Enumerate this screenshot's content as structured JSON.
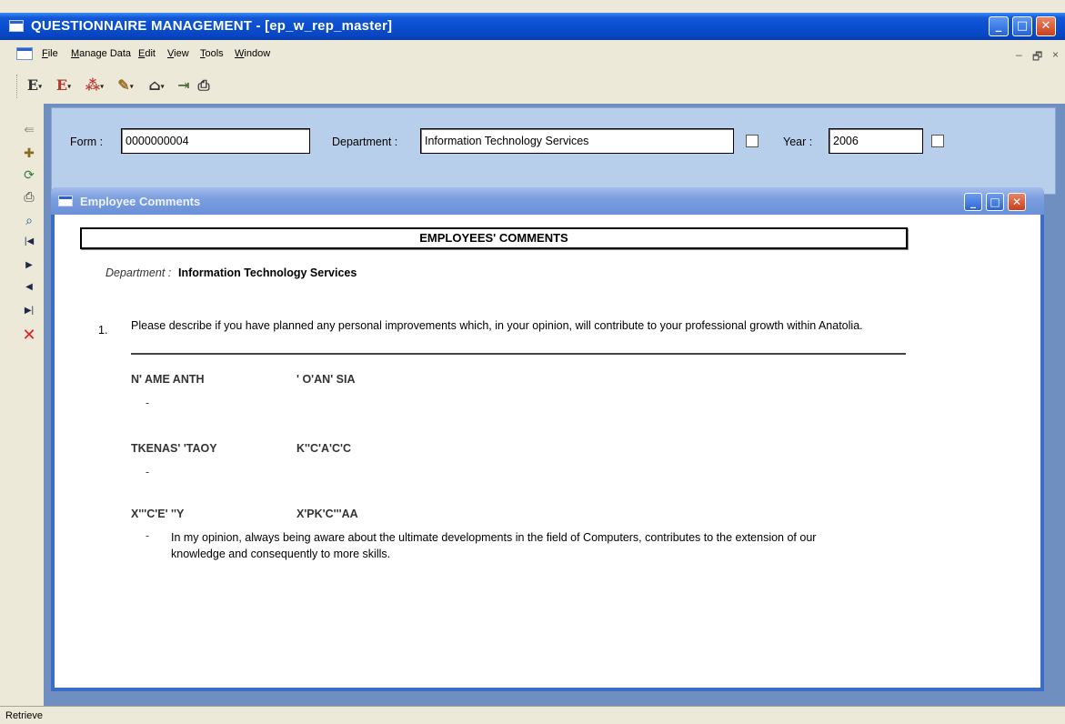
{
  "window": {
    "title": "QUESTIONNAIRE MANAGEMENT - [ep_w_rep_master]"
  },
  "menu": [
    "File",
    "Manage Data",
    "Edit",
    "View",
    "Tools",
    "Window"
  ],
  "mdi_controls": {
    "minimize": "–",
    "restore": "🗗",
    "close": "×"
  },
  "toolbar": {
    "buttons": [
      {
        "name": "en-language-icon",
        "glyph": "E"
      },
      {
        "name": "gr-language-icon",
        "glyph": "E"
      },
      {
        "name": "group-icon",
        "glyph": "⁂"
      },
      {
        "name": "brush-icon",
        "glyph": "✎"
      },
      {
        "name": "institution-icon",
        "glyph": "⌂"
      },
      {
        "name": "exit-icon",
        "glyph": "⇥"
      },
      {
        "name": "print-icon",
        "glyph": "⎙"
      }
    ]
  },
  "side_toolbar": [
    "⇚",
    "✚",
    "⟳",
    "⎙",
    "⌕",
    "|◀",
    "▶",
    "◀",
    "▶|",
    "✕"
  ],
  "form": {
    "form_label": "Form :",
    "form_value": "0000000004",
    "department_label": "Department :",
    "department_value": "Information Technology Services",
    "year_label": "Year :",
    "year_value": "2006"
  },
  "child_window": {
    "title": "Employee Comments",
    "heading": "EMPLOYEES' COMMENTS",
    "department_label": "Department :",
    "department_value": "Information Technology Services",
    "question_number": "1.",
    "question_text": "Please describe if you have planned any personal improvements which, in your opinion, will contribute to your professional growth within Anatolia.",
    "entries": [
      {
        "name_a": "N' AME ANTH",
        "name_b": "' O'AN' SIA",
        "dash": "-"
      },
      {
        "name_a": "TKENAS' 'TAOY",
        "name_b": "K''C'A'C'C",
        "dash": "-"
      },
      {
        "name_a": "X'''C'E' ''Y",
        "name_b": "X'PK'C'''AA",
        "dash": "-",
        "comment": "In my opinion, always being aware about the ultimate developments in the field of Computers, contributes to the extension of our knowledge and consequently to more skills."
      }
    ]
  },
  "status": "Retrieve"
}
